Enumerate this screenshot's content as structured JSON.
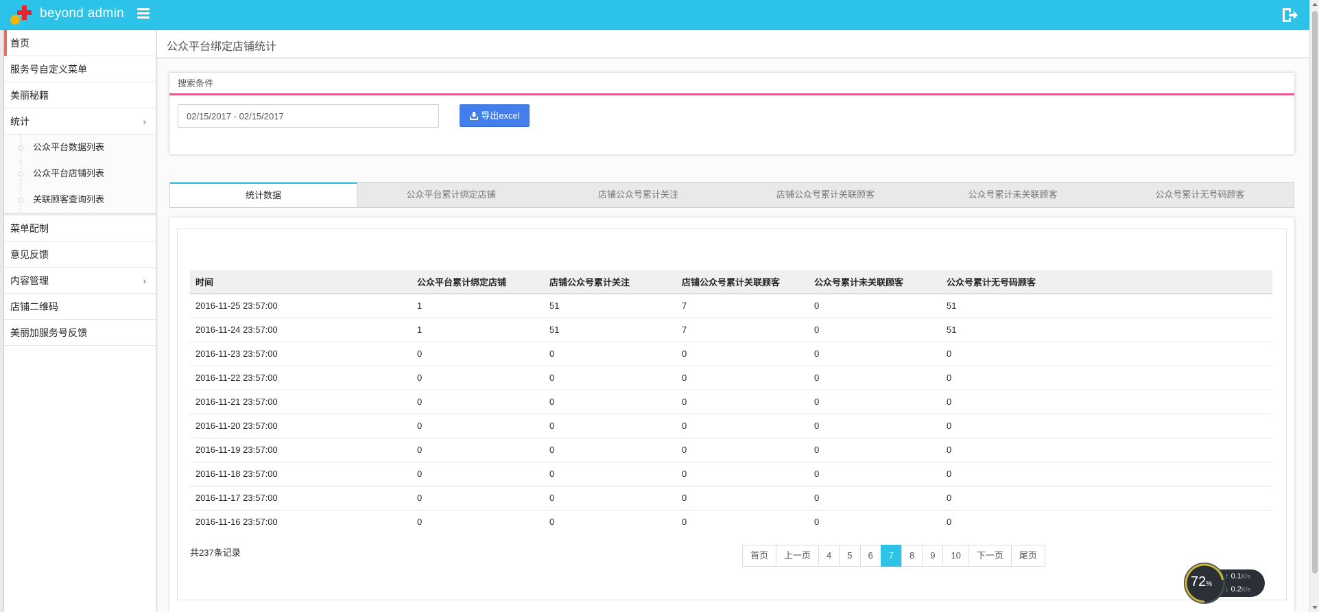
{
  "brand": "beyond admin",
  "colors": {
    "navbar": "#2dc3e8",
    "accent": "#2dc3e8",
    "export_button": "#427fed",
    "search_underline": "#e75b8d",
    "active_menu_bar": "#e46f61"
  },
  "sidebar": {
    "items": [
      {
        "label": "首页",
        "active": true
      },
      {
        "label": "服务号自定义菜单"
      },
      {
        "label": "美丽秘籍"
      },
      {
        "label": "统计",
        "arrow": "›",
        "expanded": true,
        "children": [
          {
            "label": "公众平台数据列表"
          },
          {
            "label": "公众平台店铺列表"
          },
          {
            "label": "关联顾客查询列表"
          }
        ]
      },
      {
        "label": "菜单配制"
      },
      {
        "label": "意见反馈"
      },
      {
        "label": "内容管理",
        "arrow": "›"
      },
      {
        "label": "店铺二维码"
      },
      {
        "label": "美丽加服务号反馈"
      }
    ]
  },
  "page": {
    "title": "公众平台绑定店铺统计"
  },
  "search": {
    "header": "搜索条件",
    "date_range": "02/15/2017 - 02/15/2017",
    "export_label": "导出excel"
  },
  "tabs": [
    {
      "label": "统计数据",
      "active": true
    },
    {
      "label": "公众平台累计绑定店铺"
    },
    {
      "label": "店铺公众号累计关注"
    },
    {
      "label": "店铺公众号累计关联顾客"
    },
    {
      "label": "公众号累计未关联顾客"
    },
    {
      "label": "公众号累计无号码顾客"
    }
  ],
  "table": {
    "columns": [
      "时间",
      "公众平台累计绑定店铺",
      "店铺公众号累计关注",
      "店铺公众号累计关联顾客",
      "公众号累计未关联顾客",
      "公众号累计无号码顾客"
    ],
    "rows": [
      [
        "2016-11-25 23:57:00",
        "1",
        "51",
        "7",
        "0",
        "51"
      ],
      [
        "2016-11-24 23:57:00",
        "1",
        "51",
        "7",
        "0",
        "51"
      ],
      [
        "2016-11-23 23:57:00",
        "0",
        "0",
        "0",
        "0",
        "0"
      ],
      [
        "2016-11-22 23:57:00",
        "0",
        "0",
        "0",
        "0",
        "0"
      ],
      [
        "2016-11-21 23:57:00",
        "0",
        "0",
        "0",
        "0",
        "0"
      ],
      [
        "2016-11-20 23:57:00",
        "0",
        "0",
        "0",
        "0",
        "0"
      ],
      [
        "2016-11-19 23:57:00",
        "0",
        "0",
        "0",
        "0",
        "0"
      ],
      [
        "2016-11-18 23:57:00",
        "0",
        "0",
        "0",
        "0",
        "0"
      ],
      [
        "2016-11-17 23:57:00",
        "0",
        "0",
        "0",
        "0",
        "0"
      ],
      [
        "2016-11-16 23:57:00",
        "0",
        "0",
        "0",
        "0",
        "0"
      ]
    ],
    "total": "共237条记录"
  },
  "pagination": {
    "items": [
      {
        "label": "首页"
      },
      {
        "label": "上一页"
      },
      {
        "label": "4"
      },
      {
        "label": "5"
      },
      {
        "label": "6"
      },
      {
        "label": "7",
        "current": true
      },
      {
        "label": "8"
      },
      {
        "label": "9"
      },
      {
        "label": "10"
      },
      {
        "label": "下一页"
      },
      {
        "label": "尾页"
      }
    ]
  },
  "speed_widget": {
    "percent": "72",
    "percent_unit": "%",
    "up": "0.1",
    "down": "0.2",
    "unit": "K/s",
    "fill": 0.72
  }
}
